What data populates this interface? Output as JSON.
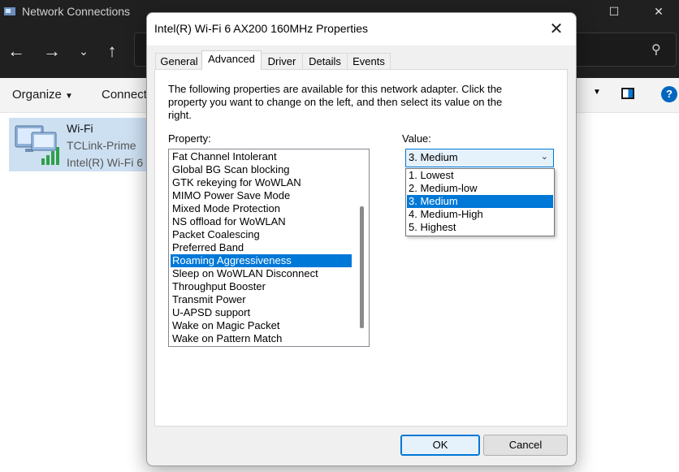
{
  "explorer": {
    "title": "Network Connections",
    "organize_label": "Organize",
    "connect_label": "Connect",
    "connection": {
      "name": "Wi-Fi",
      "network": "TCLink-Prime",
      "device": "Intel(R) Wi-Fi 6"
    }
  },
  "dialog": {
    "title": "Intel(R) Wi-Fi 6 AX200 160MHz Properties",
    "tabs": [
      "General",
      "Advanced",
      "Driver",
      "Details",
      "Events"
    ],
    "active_tab": "Advanced",
    "description": "The following properties are available for this network adapter. Click the property you want to change on the left, and then select its value on the right.",
    "property_label": "Property:",
    "value_label": "Value:",
    "properties": [
      "Fat Channel Intolerant",
      "Global BG Scan blocking",
      "GTK rekeying for WoWLAN",
      "MIMO Power Save Mode",
      "Mixed Mode Protection",
      "NS offload for WoWLAN",
      "Packet Coalescing",
      "Preferred Band",
      "Roaming Aggressiveness",
      "Sleep on WoWLAN Disconnect",
      "Throughput Booster",
      "Transmit Power",
      "U-APSD support",
      "Wake on Magic Packet",
      "Wake on Pattern Match"
    ],
    "selected_property": "Roaming Aggressiveness",
    "value_selected": "3. Medium",
    "value_options": [
      "1. Lowest",
      "2. Medium-low",
      "3. Medium",
      "4. Medium-High",
      "5. Highest"
    ],
    "ok_label": "OK",
    "cancel_label": "Cancel"
  },
  "colors": {
    "accent": "#0078d7",
    "titlebar_dark": "#202020",
    "dialog_bg": "#f0f0f0"
  }
}
